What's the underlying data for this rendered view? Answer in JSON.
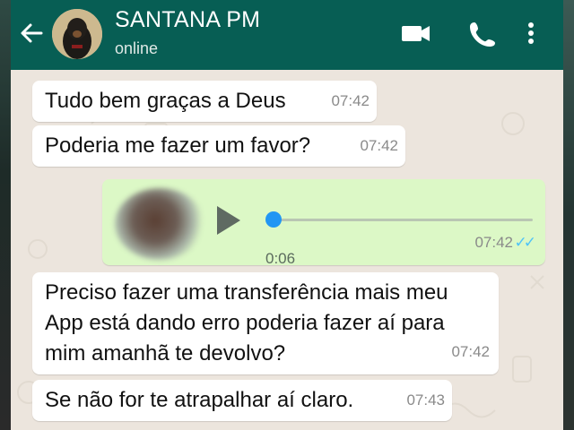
{
  "header": {
    "contact_name": "SANTANA PM",
    "status": "online",
    "back_icon": "arrow-left-icon",
    "video_icon": "video-call-icon",
    "call_icon": "phone-icon",
    "menu_icon": "more-vert-icon"
  },
  "colors": {
    "header_bg": "#075e54",
    "incoming_bubble": "#ffffff",
    "outgoing_bubble": "#dcf8c6",
    "chat_bg": "#ece5dd",
    "read_ticks": "#4fc3f7",
    "audio_knob": "#2196f3"
  },
  "messages": [
    {
      "direction": "in",
      "text": "Tudo bem graças a Deus",
      "time": "07:42"
    },
    {
      "direction": "in",
      "text": "Poderia me fazer um favor?",
      "time": "07:42"
    },
    {
      "direction": "out",
      "type": "audio",
      "duration": "0:06",
      "time": "07:42",
      "progress": 0,
      "ticks": "✓✓"
    },
    {
      "direction": "in",
      "text": "Preciso fazer uma transferência mais meu\nApp está dando erro poderia fazer aí para\nmim amanhã te devolvo?",
      "time": "07:42"
    },
    {
      "direction": "in",
      "text": "Se não for te atrapalhar aí claro.",
      "time": "07:43"
    }
  ]
}
